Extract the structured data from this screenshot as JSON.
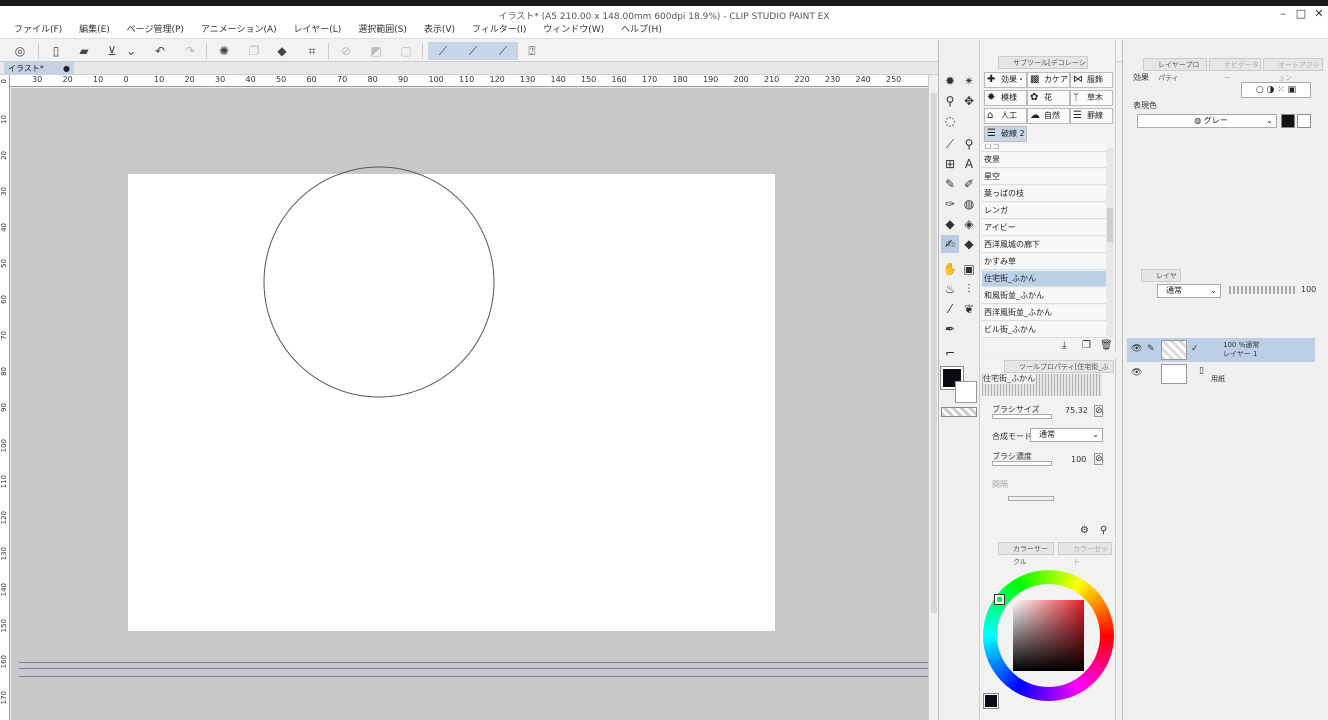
{
  "window": {
    "title": "イラスト* (A5 210.00 x 148.00mm 600dpi 18.9%) - CLIP STUDIO PAINT EX",
    "minimize_icon": "minimize-icon",
    "maximize_icon": "maximize-icon",
    "close_icon": "close-icon"
  },
  "menu": [
    "ファイル(F)",
    "編集(E)",
    "ページ管理(P)",
    "アニメーション(A)",
    "レイヤー(L)",
    "選択範囲(S)",
    "表示(V)",
    "フィルター(I)",
    "ウィンドウ(W)",
    "ヘルプ(H)"
  ],
  "document_tab": {
    "label": "イラスト*",
    "dot": "●"
  },
  "ruler": {
    "h_labels": [
      "30",
      "20",
      "10",
      "0",
      "10",
      "20",
      "30",
      "40",
      "50",
      "60",
      "70",
      "80",
      "90",
      "100",
      "110",
      "120",
      "130",
      "140",
      "150",
      "160",
      "170",
      "180",
      "190",
      "200",
      "210",
      "220",
      "230",
      "240",
      "250"
    ],
    "v_labels": [
      "0",
      "10",
      "20",
      "30",
      "40",
      "50",
      "60",
      "70",
      "80",
      "90",
      "100",
      "110",
      "120",
      "130",
      "140",
      "150",
      "160",
      "170"
    ]
  },
  "subtool": {
    "tab_label": "サブツール[デコレーション]",
    "categories": [
      "効果・",
      "カケア",
      "服飾",
      "模様",
      "花",
      "草木",
      "人工",
      "自然",
      "罫線",
      "破線 2"
    ],
    "items": [
      "夜景",
      "星空",
      "葉っぱの枝",
      "レンガ",
      "アイビー",
      "西洋風城の廊下",
      "かすみ草",
      "住宅街_ふかん",
      "和風街並_ふかん",
      "西洋風街並_ふかん",
      "ビル街_ふかん"
    ],
    "selected_item": "住宅街_ふかん",
    "partial_item": "ロゴ"
  },
  "tool_property": {
    "tab_label": "ツールプロパティ[住宅街_ふ",
    "brush_name": "住宅街_ふかん",
    "brush_size_label": "ブラシサイズ",
    "brush_size_value": "75.32",
    "blend_mode_label": "合成モード",
    "blend_mode_value": "通常",
    "brush_density_label": "ブラシ濃度",
    "brush_density_value": "100",
    "interval_label": "間隔"
  },
  "color_panel": {
    "tab_label": "カラーサークル",
    "tab2_label": "カラーセット",
    "main_color": "#0b0b14",
    "sub_color": "#ffffff"
  },
  "layer_property": {
    "tab_label": "レイヤープロパティ",
    "tab2_label": "ナビゲーター",
    "tab3_label": "オートアクション",
    "effect_label": "効果",
    "expression_color_label": "表現色",
    "expression_color_value": "グレー"
  },
  "layers": {
    "tab_label": "レイヤー",
    "blend_mode": "通常",
    "opacity": "100",
    "rows": [
      {
        "line1": "100 %通常",
        "line2": "レイヤー 1"
      },
      {
        "line1": "",
        "line2": "用紙"
      }
    ]
  }
}
